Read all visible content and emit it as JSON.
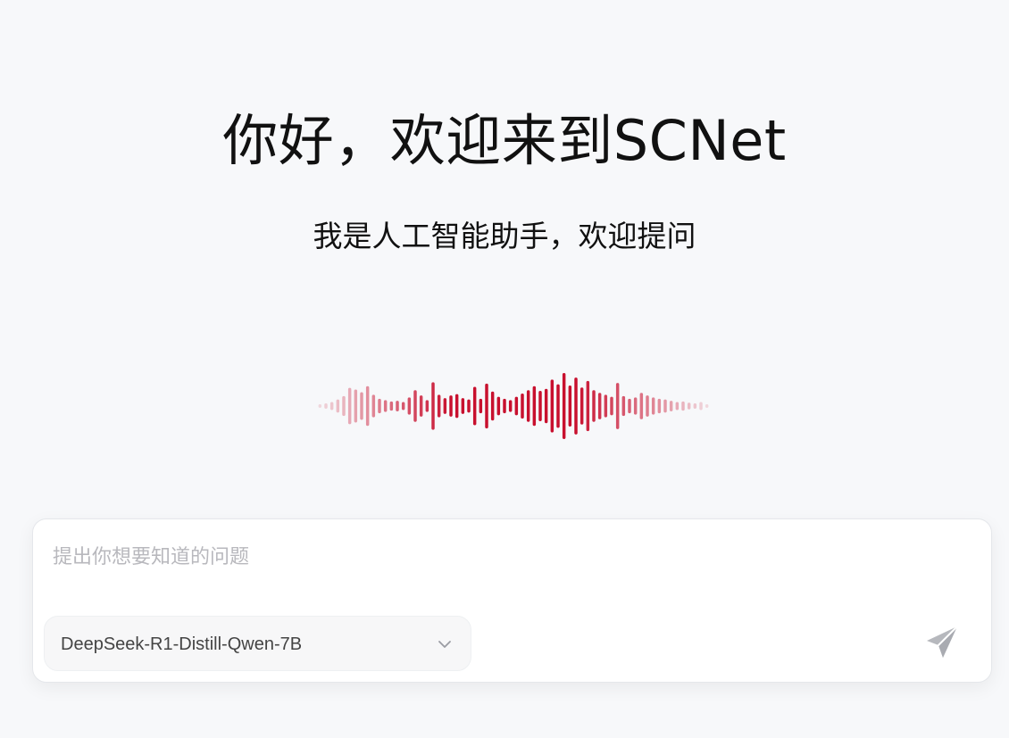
{
  "hero": {
    "title": "你好，欢迎来到SCNet",
    "subtitle": "我是人工智能助手，欢迎提问"
  },
  "waveform": {
    "icon": "audio-waveform-icon",
    "color": "#c8102e",
    "bar_levels": [
      0.05,
      0.08,
      0.12,
      0.2,
      0.3,
      0.55,
      0.5,
      0.42,
      0.6,
      0.34,
      0.22,
      0.18,
      0.14,
      0.16,
      0.12,
      0.26,
      0.48,
      0.32,
      0.18,
      0.72,
      0.34,
      0.24,
      0.32,
      0.36,
      0.24,
      0.2,
      0.58,
      0.22,
      0.68,
      0.44,
      0.28,
      0.22,
      0.18,
      0.28,
      0.38,
      0.48,
      0.6,
      0.46,
      0.52,
      0.8,
      0.66,
      1.0,
      0.62,
      0.86,
      0.56,
      0.76,
      0.48,
      0.4,
      0.34,
      0.28,
      0.7,
      0.3,
      0.22,
      0.26,
      0.4,
      0.32,
      0.26,
      0.22,
      0.2,
      0.16,
      0.12,
      0.14,
      0.1,
      0.08,
      0.12,
      0.05
    ]
  },
  "composer": {
    "placeholder": "提出你想要知道的问题",
    "value": "",
    "model": {
      "selected": "DeepSeek-R1-Distill-Qwen-7B",
      "icon": "chevron-down-icon"
    },
    "send_icon": "paper-plane-icon",
    "colors": {
      "send_icon": "#b6b8bd",
      "chevron": "#9a9ca3"
    }
  }
}
